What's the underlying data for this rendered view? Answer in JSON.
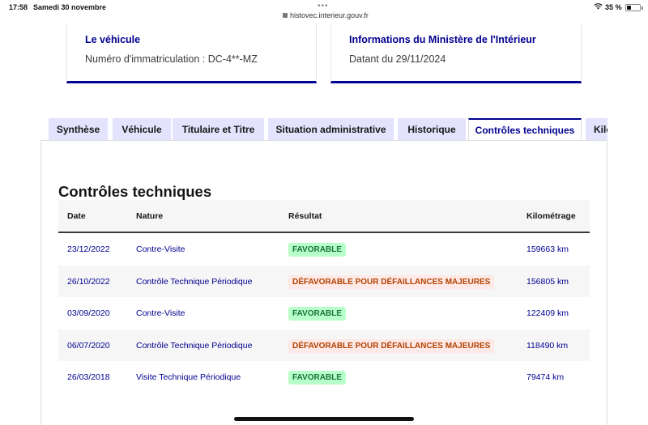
{
  "status_bar": {
    "time": "17:58",
    "date": "Samedi 30 novembre",
    "url": "histovec.interieur.gouv.fr",
    "battery": "35 %",
    "battery_level": 0.35,
    "dots": "•••"
  },
  "cards": [
    {
      "title": "Le véhicule",
      "text": "Numéro d'immatriculation : DC-4**-MZ"
    },
    {
      "title": "Informations du Ministère de l'Intérieur",
      "text": "Datant du 29/11/2024"
    }
  ],
  "tabs": [
    {
      "label": "Synthèse",
      "active": false
    },
    {
      "label": "Véhicule",
      "active": false
    },
    {
      "label": "Titulaire et Titre",
      "active": false
    },
    {
      "label": "Situation administrative",
      "active": false
    },
    {
      "label": "Historique",
      "active": false
    },
    {
      "label": "Contrôles techniques",
      "active": true
    },
    {
      "label": "Kilométrage",
      "active": false
    }
  ],
  "section": {
    "title": "Contrôles techniques",
    "columns": [
      "Date",
      "Nature",
      "Résultat",
      "Kilométrage"
    ],
    "rows": [
      {
        "date": "23/12/2022",
        "nature": "Contre-Visite",
        "result": "FAVORABLE",
        "status": "ok",
        "km": "159663 km"
      },
      {
        "date": "26/10/2022",
        "nature": "Contrôle Technique Périodique",
        "result": "DÉFAVORABLE POUR DÉFAILLANCES MAJEURES",
        "status": "ko",
        "km": "156805 km"
      },
      {
        "date": "03/09/2020",
        "nature": "Contre-Visite",
        "result": "FAVORABLE",
        "status": "ok",
        "km": "122409 km"
      },
      {
        "date": "06/07/2020",
        "nature": "Contrôle Technique Périodique",
        "result": "DÉFAVORABLE POUR DÉFAILLANCES MAJEURES",
        "status": "ko",
        "km": "118490 km"
      },
      {
        "date": "26/03/2018",
        "nature": "Visite Technique Périodique",
        "result": "FAVORABLE",
        "status": "ok",
        "km": "79474 km"
      }
    ]
  },
  "colors": {
    "primary": "#000091",
    "tab_bg": "#e3e3fd",
    "success_bg": "#b8fec9",
    "success_text": "#18753c",
    "error_bg": "#ffe9e6",
    "error_text": "#b34000"
  }
}
